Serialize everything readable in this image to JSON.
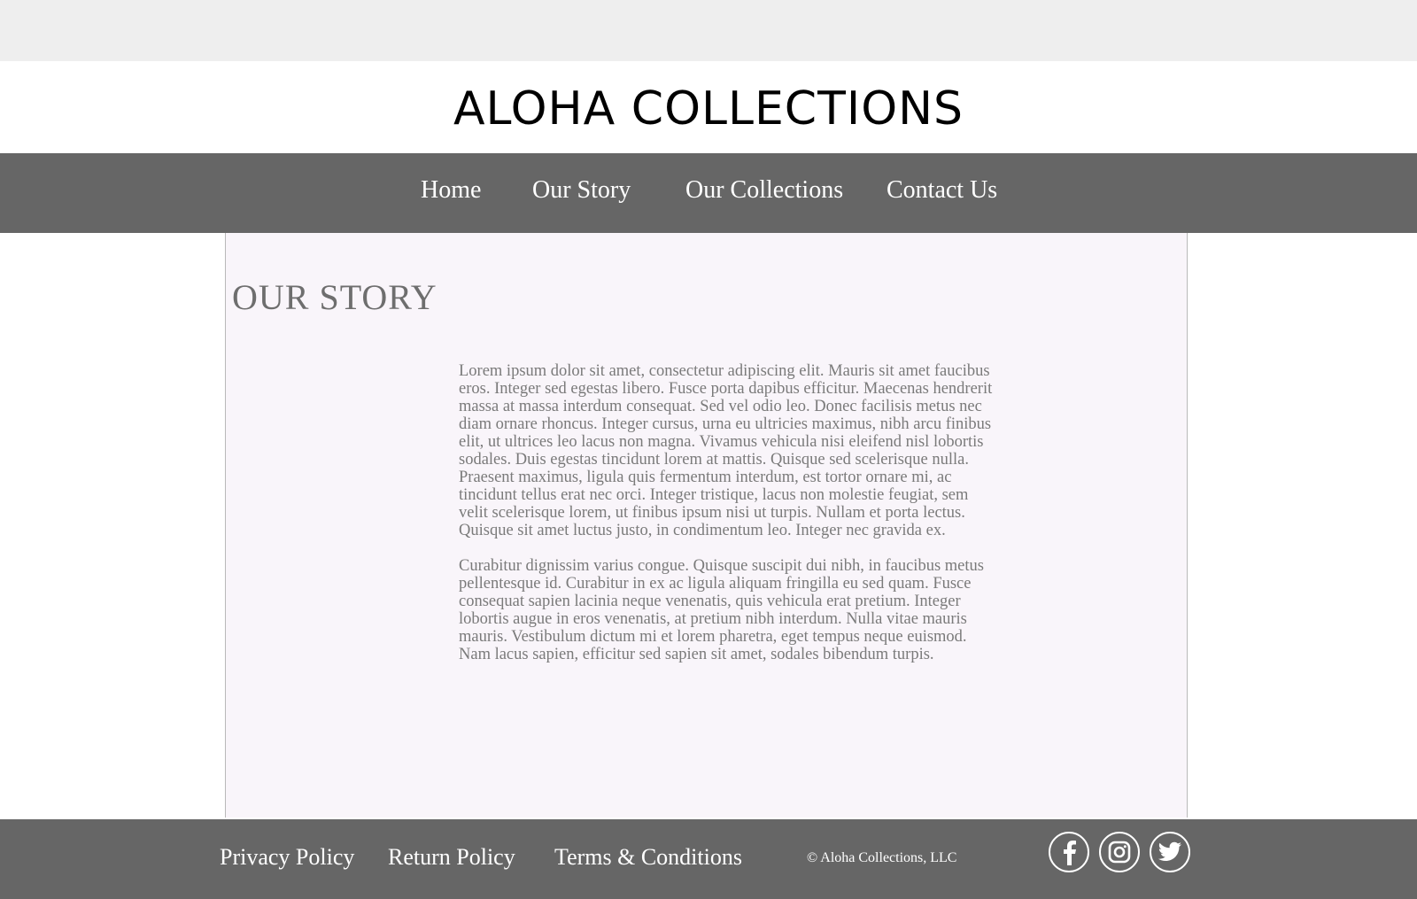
{
  "brand": {
    "title": "ALOHA COLLECTIONS"
  },
  "nav": {
    "items": [
      {
        "label": "Home"
      },
      {
        "label": "Our Story"
      },
      {
        "label": "Our Collections"
      },
      {
        "label": "Contact Us"
      }
    ]
  },
  "main": {
    "title": "OUR STORY",
    "paragraphs": [
      "Lorem ipsum dolor sit amet, consectetur adipiscing elit. Mauris sit amet faucibus eros. Integer sed egestas libero. Fusce porta dapibus efficitur. Maecenas hendrerit massa at massa interdum consequat. Sed vel odio leo. Donec facilisis metus nec diam ornare rhoncus. Integer cursus, urna eu ultricies maximus, nibh arcu finibus elit, ut ultrices leo lacus non magna. Vivamus vehicula nisi eleifend nisl lobortis sodales. Duis egestas tincidunt lorem at mattis. Quisque sed scelerisque nulla. Praesent maximus, ligula quis fermentum interdum, est tortor ornare mi, ac tincidunt tellus erat nec orci. Integer tristique, lacus non molestie feugiat, sem velit scelerisque lorem, ut finibus ipsum nisi ut turpis. Nullam et porta lectus. Quisque sit amet luctus justo, in condimentum leo. Integer nec gravida ex.",
      "Curabitur dignissim varius congue. Quisque suscipit dui nibh, in faucibus metus pellentesque id. Curabitur in ex ac ligula aliquam fringilla eu sed quam. Fusce consequat sapien lacinia neque venenatis, quis vehicula erat pretium. Integer lobortis augue in eros venenatis, at pretium nibh interdum. Nulla vitae mauris mauris. Vestibulum dictum mi et lorem pharetra, eget tempus neque euismod. Nam lacus sapien, efficitur sed sapien sit amet, sodales bibendum turpis."
    ]
  },
  "footer": {
    "links": [
      {
        "label": "Privacy Policy"
      },
      {
        "label": "Return Policy"
      },
      {
        "label": "Terms & Conditions"
      }
    ],
    "copyright": "© Aloha Collections, LLC",
    "social": [
      {
        "icon": "facebook-icon"
      },
      {
        "icon": "instagram-icon"
      },
      {
        "icon": "twitter-icon"
      }
    ]
  },
  "colors": {
    "top_strip": "#eeeeee",
    "nav_bg": "#666666",
    "content_bg": "#f9f5fa",
    "title_text": "#6e6e6e",
    "body_text": "#7a7a7a"
  }
}
